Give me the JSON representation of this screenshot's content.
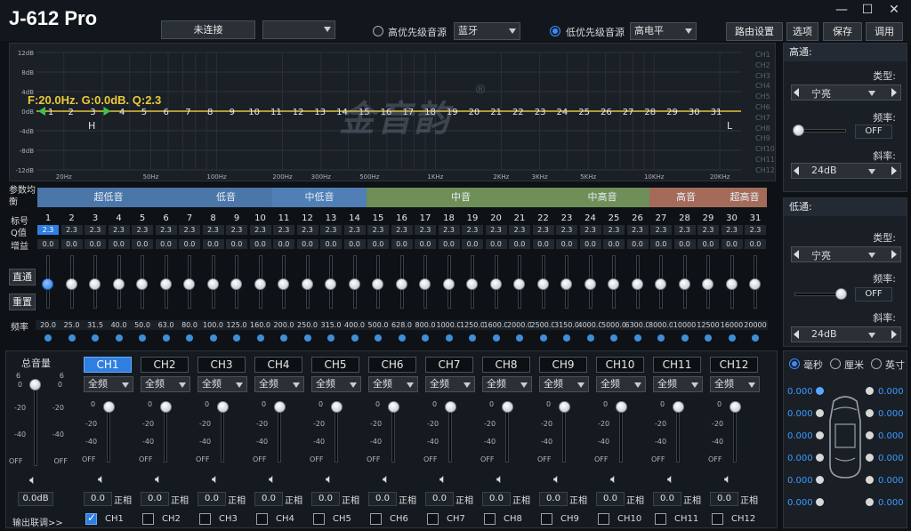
{
  "app": {
    "title": "J-612 Pro"
  },
  "header": {
    "connect_label": "未连接",
    "high_source_label": "高优先级音源",
    "high_source_value": "蓝牙",
    "low_source_label": "低优先级音源",
    "low_source_value": "高电平",
    "buttons": [
      "路由设置",
      "选项",
      "保存",
      "调用"
    ],
    "window_controls": {
      "min": "—",
      "max": "☐",
      "close": "✕"
    }
  },
  "graph": {
    "readout": "F:20.0Hz. G:0.0dB. Q:2.3",
    "db_labels": [
      "12dB",
      "8dB",
      "4dB",
      "0dB",
      "-4dB",
      "-8dB",
      "-12dB"
    ],
    "freq_labels": [
      "20Hz",
      "50Hz",
      "100Hz",
      "200Hz",
      "300Hz",
      "500Hz",
      "1KHz",
      "2KHz",
      "3KHz",
      "5KHz",
      "10KHz",
      "20KHz"
    ],
    "ch_list": [
      "CH1",
      "CH2",
      "CH3",
      "CH4",
      "CH5",
      "CH6",
      "CH7",
      "CH8",
      "CH9",
      "CH10",
      "CH11",
      "CH12"
    ],
    "marker_h": "H",
    "marker_l": "L",
    "watermark": "金音韵",
    "reg": "®"
  },
  "eq": {
    "param_label": "参数均衡",
    "bands": [
      {
        "name": "超低音",
        "color": "#4a76a8"
      },
      {
        "name": "低音",
        "color": "#4a76a8"
      },
      {
        "name": "中低音",
        "color": "#4f7fb5"
      },
      {
        "name": "中音",
        "color": "#6e8f58"
      },
      {
        "name": "中高音",
        "color": "#6e8f58"
      },
      {
        "name": "高音",
        "color": "#a46b5a"
      },
      {
        "name": "超高音",
        "color": "#a46b5a"
      }
    ],
    "row_labels": {
      "index": "标号",
      "q": "Q值",
      "gain": "增益",
      "freq": "频率"
    },
    "indices": [
      "1",
      "2",
      "3",
      "4",
      "5",
      "6",
      "7",
      "8",
      "9",
      "10",
      "11",
      "12",
      "13",
      "14",
      "15",
      "16",
      "17",
      "18",
      "19",
      "20",
      "21",
      "22",
      "23",
      "24",
      "25",
      "26",
      "27",
      "28",
      "29",
      "30",
      "31"
    ],
    "q_values": [
      "2.3",
      "2.3",
      "2.3",
      "2.3",
      "2.3",
      "2.3",
      "2.3",
      "2.3",
      "2.3",
      "2.3",
      "2.3",
      "2.3",
      "2.3",
      "2.3",
      "2.3",
      "2.3",
      "2.3",
      "2.3",
      "2.3",
      "2.3",
      "2.3",
      "2.3",
      "2.3",
      "2.3",
      "2.3",
      "2.3",
      "2.3",
      "2.3",
      "2.3",
      "2.3",
      "2.3"
    ],
    "gains": [
      "0.0",
      "0.0",
      "0.0",
      "0.0",
      "0.0",
      "0.0",
      "0.0",
      "0.0",
      "0.0",
      "0.0",
      "0.0",
      "0.0",
      "0.0",
      "0.0",
      "0.0",
      "0.0",
      "0.0",
      "0.0",
      "0.0",
      "0.0",
      "0.0",
      "0.0",
      "0.0",
      "0.0",
      "0.0",
      "0.0",
      "0.0",
      "0.0",
      "0.0",
      "0.0",
      "0.0"
    ],
    "freqs": [
      "20.0",
      "25.0",
      "31.5",
      "40.0",
      "50.0",
      "63.0",
      "80.0",
      "100.0",
      "125.0",
      "160.0",
      "200.0",
      "250.0",
      "315.0",
      "400.0",
      "500.0",
      "628.0",
      "800.0",
      "1000.0",
      "1250.0",
      "1600.0",
      "2000.0",
      "2500.0",
      "3150.0",
      "4000.0",
      "5000.0",
      "6300.0",
      "8000.0",
      "10000",
      "12500",
      "16000",
      "20000"
    ],
    "bypass_label": "直通",
    "reset_label": "重置"
  },
  "highpass": {
    "title": "高通:",
    "type_label": "类型:",
    "type_value": "宁亮",
    "freq_label": "频率:",
    "freq_value": "OFF",
    "slope_label": "斜率:",
    "slope_value": "24dB"
  },
  "lowpass": {
    "title": "低通:",
    "type_label": "类型:",
    "type_value": "宁亮",
    "freq_label": "频率:",
    "freq_value": "OFF",
    "slope_label": "斜率:",
    "slope_value": "24dB"
  },
  "master": {
    "title": "总音量",
    "value": "0.0dB",
    "scale": [
      "0",
      "-20",
      "-40",
      "OFF"
    ],
    "scale_top": "6"
  },
  "channels": {
    "names": [
      "CH1",
      "CH2",
      "CH3",
      "CH4",
      "CH5",
      "CH6",
      "CH7",
      "CH8",
      "CH9",
      "CH10",
      "CH11",
      "CH12"
    ],
    "filter": "全频",
    "scale": [
      "0",
      "-20",
      "-40",
      "OFF"
    ],
    "value": "0.0",
    "phase": "正相",
    "link_label": "输出联调>>"
  },
  "delay": {
    "units": [
      "毫秒",
      "厘米",
      "英寸"
    ],
    "left_values": [
      "0.000",
      "0.000",
      "0.000",
      "0.000",
      "0.000",
      "0.000"
    ],
    "right_values": [
      "0.000",
      "0.000",
      "0.000",
      "0.000",
      "0.000",
      "0.000"
    ]
  }
}
